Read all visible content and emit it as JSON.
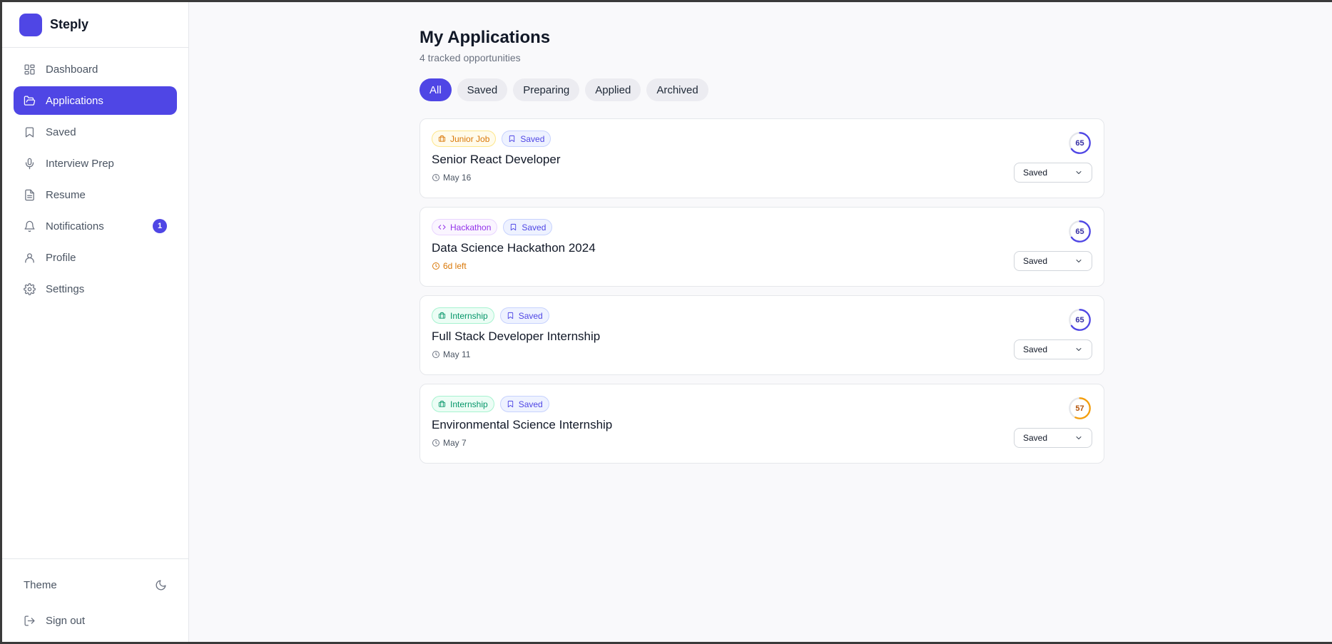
{
  "brand": {
    "name": "Steply",
    "color": "#4f46e5"
  },
  "sidebar": {
    "items": [
      {
        "label": "Dashboard",
        "icon": "dashboard-icon"
      },
      {
        "label": "Applications",
        "icon": "folder-open-icon",
        "active": true
      },
      {
        "label": "Saved",
        "icon": "bookmark-icon"
      },
      {
        "label": "Interview Prep",
        "icon": "microphone-icon"
      },
      {
        "label": "Resume",
        "icon": "document-icon"
      },
      {
        "label": "Notifications",
        "icon": "bell-icon",
        "badge": "1"
      },
      {
        "label": "Profile",
        "icon": "user-icon"
      },
      {
        "label": "Settings",
        "icon": "gear-icon"
      }
    ],
    "theme_label": "Theme",
    "signout_label": "Sign out"
  },
  "header": {
    "title": "My Applications",
    "subtitle": "4 tracked opportunities"
  },
  "filters": [
    "All",
    "Saved",
    "Preparing",
    "Applied",
    "Archived"
  ],
  "active_filter": "All",
  "applications": [
    {
      "type": "Junior Job",
      "type_icon": "briefcase-icon",
      "status_tag": "Saved",
      "title": "Senior React Developer",
      "date": "May 16",
      "date_warn": false,
      "score": "65",
      "score_color": "#4f46e5",
      "status": "Saved"
    },
    {
      "type": "Hackathon",
      "type_icon": "code-icon",
      "status_tag": "Saved",
      "title": "Data Science Hackathon 2024",
      "date": "6d left",
      "date_warn": true,
      "score": "65",
      "score_color": "#4f46e5",
      "status": "Saved"
    },
    {
      "type": "Internship",
      "type_icon": "briefcase-icon",
      "status_tag": "Saved",
      "title": "Full Stack Developer Internship",
      "date": "May 11",
      "date_warn": false,
      "score": "65",
      "score_color": "#4f46e5",
      "status": "Saved"
    },
    {
      "type": "Internship",
      "type_icon": "briefcase-icon",
      "status_tag": "Saved",
      "title": "Environmental Science Internship",
      "date": "May 7",
      "date_warn": false,
      "score": "57",
      "score_color": "#f59e0b",
      "status": "Saved"
    }
  ]
}
